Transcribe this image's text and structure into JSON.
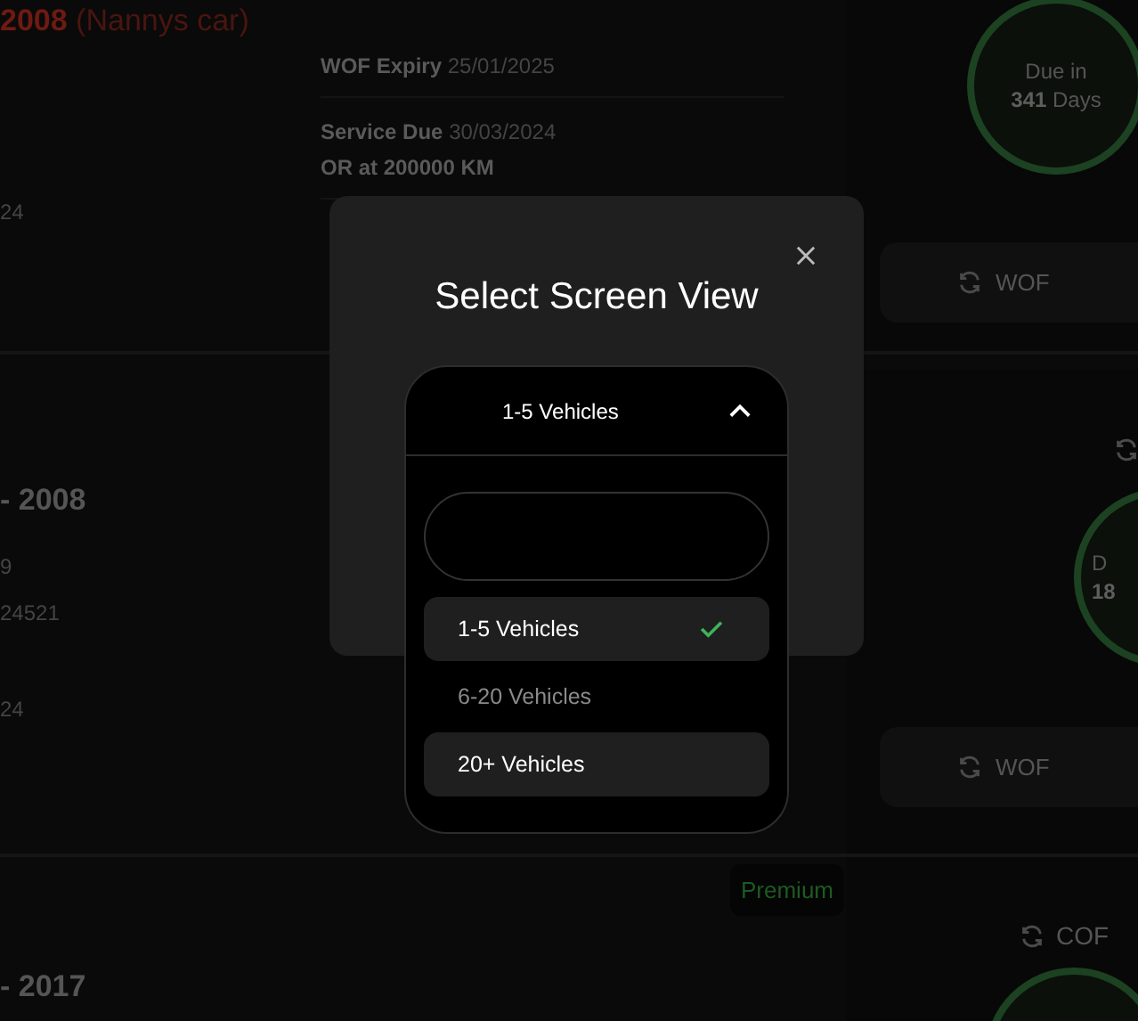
{
  "cards": [
    {
      "title": "2008",
      "subtitle": "(Nannys car)",
      "left_values": [
        "24"
      ],
      "details": [
        {
          "label": "WOF Expiry",
          "value": "25/01/2025"
        },
        {
          "label": "Service Due",
          "value": "30/03/2024",
          "note": "OR at 200000 KM"
        }
      ],
      "due": {
        "line1": "Due in",
        "count": "341",
        "unit": "Days"
      },
      "action": "WOF"
    },
    {
      "title": "- 2008",
      "left_values": [
        "9",
        "24521",
        "24"
      ],
      "cycle": {
        "shown": true
      },
      "due": {
        "line1": "D",
        "count": "18"
      },
      "action": "WOF"
    },
    {
      "title": "- 2017",
      "badge": "Premium",
      "cycle": {
        "shown": true,
        "label": "COF"
      },
      "due": {
        "cut": true
      }
    }
  ],
  "modal": {
    "title": "Select Screen View",
    "dropdown": {
      "value": "1-5 Vehicles",
      "expanded": true,
      "options": [
        {
          "label": "1-5 Vehicles",
          "selected": true,
          "highlighted": true
        },
        {
          "label": "6-20 Vehicles",
          "selected": false,
          "highlighted": false
        },
        {
          "label": "20+ Vehicles",
          "selected": false,
          "highlighted": true
        }
      ]
    }
  }
}
